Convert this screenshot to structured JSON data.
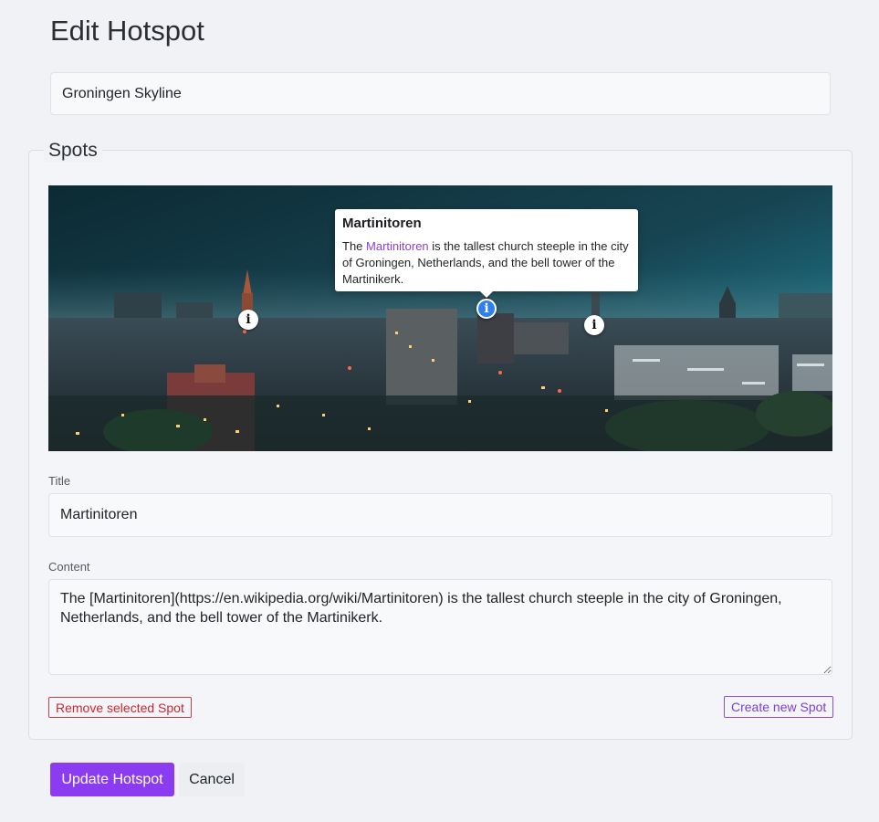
{
  "page": {
    "title": "Edit Hotspot"
  },
  "hotspot": {
    "name": "Groningen Skyline"
  },
  "spots": {
    "legend": "Spots",
    "markers": [
      {
        "icon": "info-icon",
        "glyph": "i",
        "state": "normal"
      },
      {
        "icon": "info-icon",
        "glyph": "i",
        "state": "selected"
      },
      {
        "icon": "info-icon",
        "glyph": "i",
        "state": "normal"
      }
    ],
    "popover": {
      "title": "Martinitoren",
      "before": "The ",
      "link_text": "Martinitoren",
      "after": " is the tallest church steeple in the city of Groningen, Netherlands, and the bell tower of the Martinikerk."
    },
    "title_label": "Title",
    "title_value": "Martinitoren",
    "content_label": "Content",
    "content_value": "The [Martinitoren](https://en.wikipedia.org/wiki/Martinitoren) is the tallest church steeple in the city of Groningen, Netherlands, and the bell tower of the Martinikerk.",
    "remove_label": "Remove selected Spot",
    "create_label": "Create new Spot"
  },
  "actions": {
    "update_label": "Update Hotspot",
    "cancel_label": "Cancel"
  },
  "colors": {
    "primary": "#8b3cf0",
    "danger": "#d9383f",
    "link": "#8b3fd9",
    "marker_active": "#2f80ed",
    "background": "#f1f2f6"
  }
}
